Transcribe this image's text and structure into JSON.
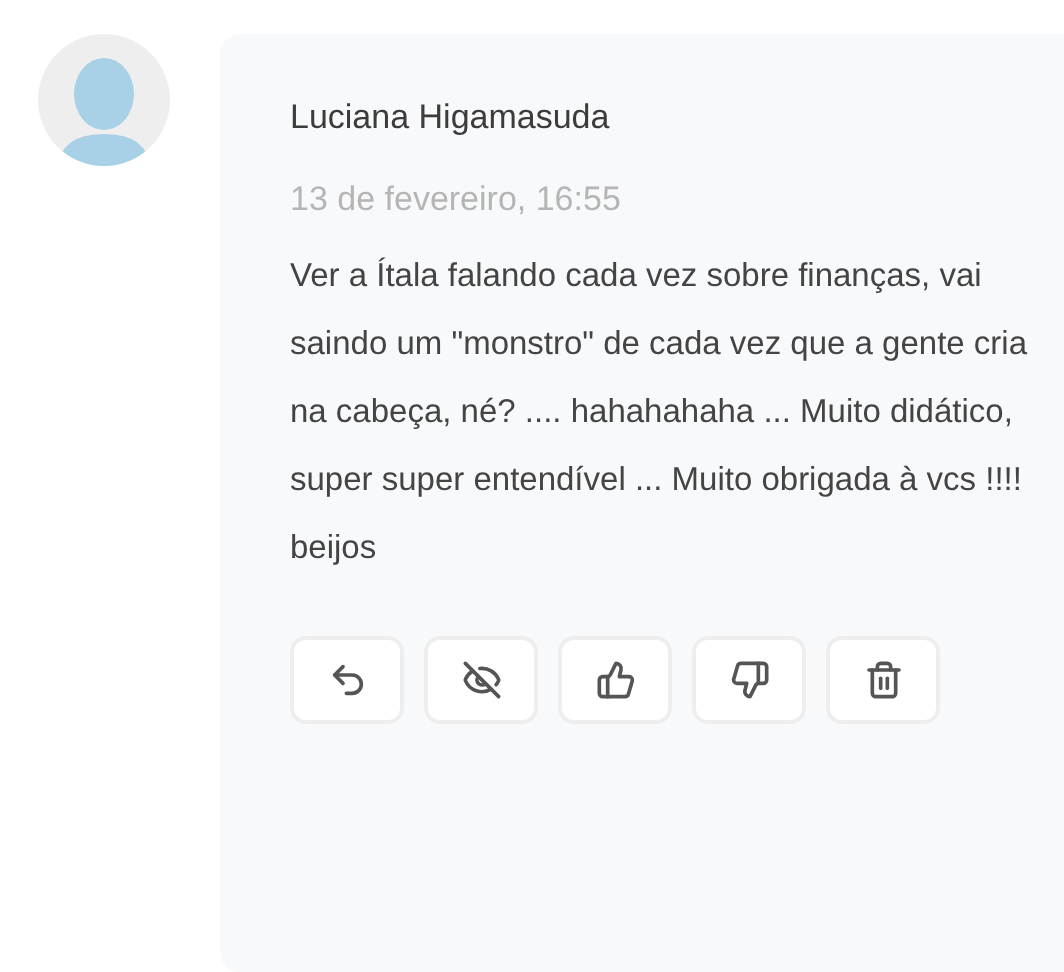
{
  "comment": {
    "author": "Luciana Higamasuda",
    "date": "13 de fevereiro, 16:55",
    "body": "Ver a Ítala falando cada vez sobre finanças, vai saindo um \"monstro\" de cada vez que a gente cria na cabeça, né? .... hahahahaha ... Muito didático, super super entendível ... Muito obrigada à vcs !!!! beijos"
  },
  "actions": [
    {
      "kind": "reply"
    },
    {
      "kind": "hide"
    },
    {
      "kind": "like"
    },
    {
      "kind": "dislike"
    },
    {
      "kind": "delete"
    }
  ]
}
